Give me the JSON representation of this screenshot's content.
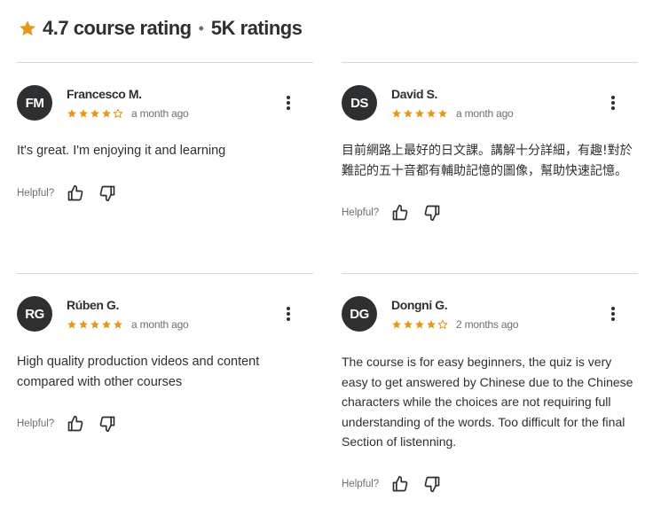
{
  "summary": {
    "rating_text": "4.7 course rating",
    "separator": "•",
    "ratings_count": "5K ratings",
    "accent_color": "#e59819"
  },
  "helpful_label": "Helpful?",
  "reviews": [
    {
      "initials": "FM",
      "name": "Francesco M.",
      "stars": 4,
      "date": "a month ago",
      "text": "It's great. I'm enjoying it and learning"
    },
    {
      "initials": "DS",
      "name": "David S.",
      "stars": 5,
      "date": "a month ago",
      "text": "目前網路上最好的日文課。講解十分詳細，有趣!對於難記的五十音都有輔助記憶的圖像，幫助快速記憶。"
    },
    {
      "initials": "RG",
      "name": "Rúben G.",
      "stars": 5,
      "date": "a month ago",
      "text": "High quality production videos and content compared with other courses"
    },
    {
      "initials": "DG",
      "name": "Dongni G.",
      "stars": 4,
      "date": "2 months ago",
      "text": "The course is for easy beginners, the quiz is very easy to get answered by Chinese due to the Chinese characters while the choices are not requiring full understanding of the words. Too difficult for the final Section of listenning."
    }
  ]
}
